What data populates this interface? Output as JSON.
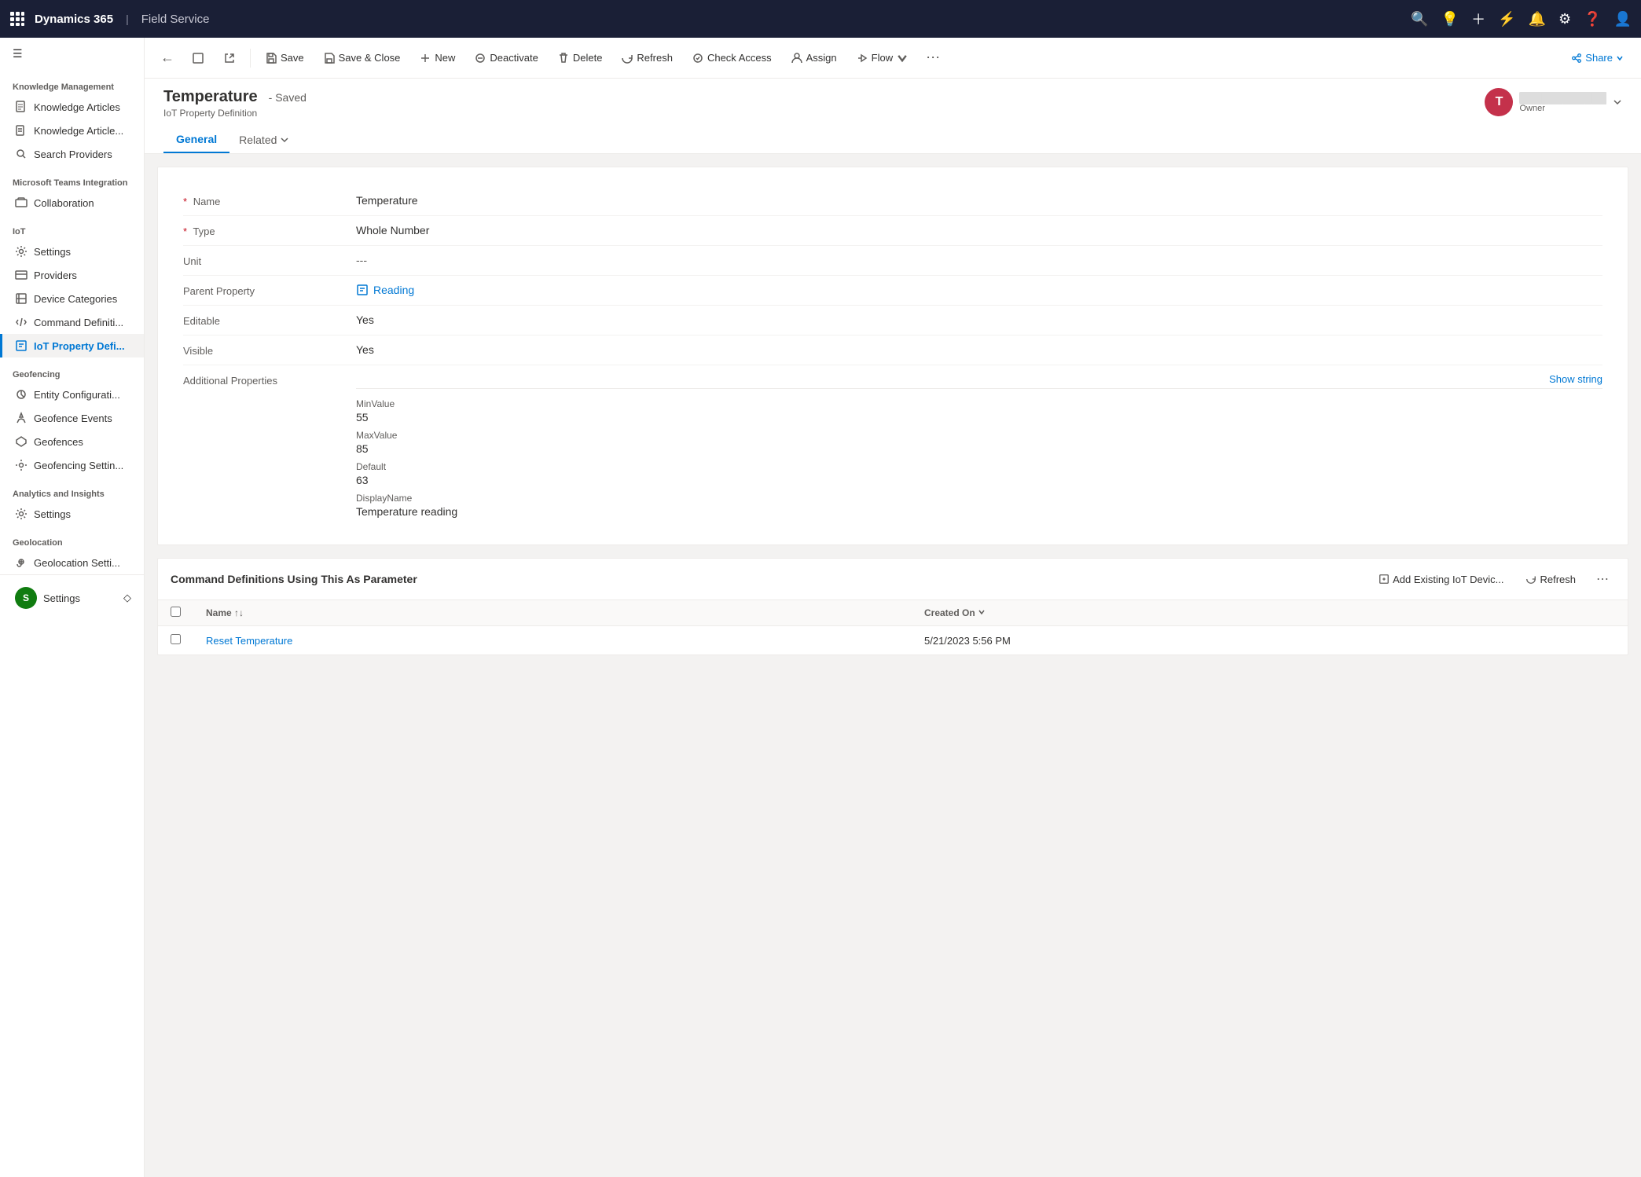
{
  "topbar": {
    "app_name": "Dynamics 365",
    "divider": "|",
    "module": "Field Service",
    "hamburger_icon": "☰"
  },
  "command_bar": {
    "back_label": "←",
    "save_label": "Save",
    "save_close_label": "Save & Close",
    "new_label": "New",
    "deactivate_label": "Deactivate",
    "delete_label": "Delete",
    "refresh_label": "Refresh",
    "check_access_label": "Check Access",
    "assign_label": "Assign",
    "flow_label": "Flow",
    "more_label": "⋯",
    "share_label": "Share"
  },
  "page": {
    "title": "Temperature",
    "saved_status": "- Saved",
    "subtitle": "IoT Property Definition",
    "owner_initial": "T",
    "owner_name": "Owner",
    "tab_general": "General",
    "tab_related": "Related"
  },
  "form": {
    "name_label": "Name",
    "name_value": "Temperature",
    "type_label": "Type",
    "type_value": "Whole Number",
    "unit_label": "Unit",
    "unit_value": "---",
    "parent_property_label": "Parent Property",
    "parent_property_value": "Reading",
    "editable_label": "Editable",
    "editable_value": "Yes",
    "visible_label": "Visible",
    "visible_value": "Yes",
    "additional_properties_label": "Additional Properties",
    "show_string_label": "Show string",
    "min_value_label": "MinValue",
    "min_value": "55",
    "max_value_label": "MaxValue",
    "max_value": "85",
    "default_label": "Default",
    "default_value": "63",
    "display_name_label": "DisplayName",
    "display_name_value": "Temperature reading"
  },
  "sub_grid": {
    "title": "Command Definitions Using This As Parameter",
    "add_label": "Add Existing IoT Devic...",
    "refresh_label": "Refresh",
    "more_label": "⋯",
    "col_name": "Name",
    "col_created_on": "Created On",
    "rows": [
      {
        "name": "Reset Temperature",
        "created_on": "5/21/2023 5:56 PM"
      }
    ]
  },
  "sidebar": {
    "hamburger": "☰",
    "knowledge_management_title": "Knowledge Management",
    "knowledge_articles": "Knowledge Articles",
    "knowledge_articles2": "Knowledge Article...",
    "search_providers": "Search Providers",
    "teams_title": "Microsoft Teams Integration",
    "collaboration": "Collaboration",
    "iot_title": "IoT",
    "settings": "Settings",
    "providers": "Providers",
    "device_categories": "Device Categories",
    "command_defini": "Command Definiti...",
    "iot_property_defi": "IoT Property Defi...",
    "geofencing_title": "Geofencing",
    "entity_configurati": "Entity Configurati...",
    "geofence_events": "Geofence Events",
    "geofences": "Geofences",
    "geofencing_settin": "Geofencing Settin...",
    "analytics_title": "Analytics and Insights",
    "analytics_settings": "Settings",
    "geolocation_title": "Geolocation",
    "geolocation_settin": "Geolocation Setti...",
    "bottom_settings": "Settings"
  }
}
